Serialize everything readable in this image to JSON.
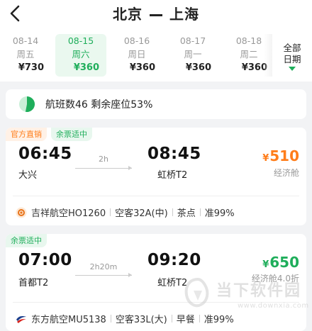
{
  "header": {
    "from": "北京",
    "to": "上海"
  },
  "dates": [
    {
      "date": "08-14",
      "weekday": "周五",
      "price": "¥730",
      "active": false
    },
    {
      "date": "08-15",
      "weekday": "周六",
      "price": "¥360",
      "active": true
    },
    {
      "date": "08-16",
      "weekday": "周日",
      "price": "¥360",
      "active": false
    },
    {
      "date": "08-17",
      "weekday": "周一",
      "price": "¥360",
      "active": false
    },
    {
      "date": "08-18",
      "weekday": "周二",
      "price": "¥360",
      "active": false
    }
  ],
  "all_dates": {
    "line1": "全部",
    "line2": "日期"
  },
  "summary": {
    "text": "航班数46 剩余座位53%",
    "seat_ratio": 0.53
  },
  "flights": [
    {
      "badges": [
        "官方直销",
        "余票适中"
      ],
      "dep_time": "06:45",
      "dep_airport": "大兴",
      "duration": "2h",
      "arr_time": "08:45",
      "arr_airport": "虹桥T2",
      "currency": "¥",
      "price": "510",
      "cabin": "经济舱",
      "airline": "吉祥航空HO1260",
      "aircraft": "空客32A(中)",
      "meal": "茶点",
      "on_time": "准99%"
    },
    {
      "badges": [
        "余票适中"
      ],
      "dep_time": "07:00",
      "dep_airport": "首都T2",
      "duration": "2h20m",
      "arr_time": "09:20",
      "arr_airport": "虹桥T2",
      "currency": "¥",
      "price": "650",
      "cabin": "经济舱4.0折",
      "airline": "东方航空MU5138",
      "aircraft": "空客33L(大)",
      "meal": "早餐",
      "on_time": "准99%"
    }
  ],
  "watermark": {
    "text": "当下软件园",
    "url": "www.downxia.com"
  },
  "colors": {
    "accent_green": "#1fae5b",
    "accent_orange": "#ff7d1a",
    "muted": "#999999"
  },
  "icons": {
    "back": "chevron-left-icon",
    "pie": "pie-chart-icon",
    "chevron": "chevron-down-icon"
  }
}
